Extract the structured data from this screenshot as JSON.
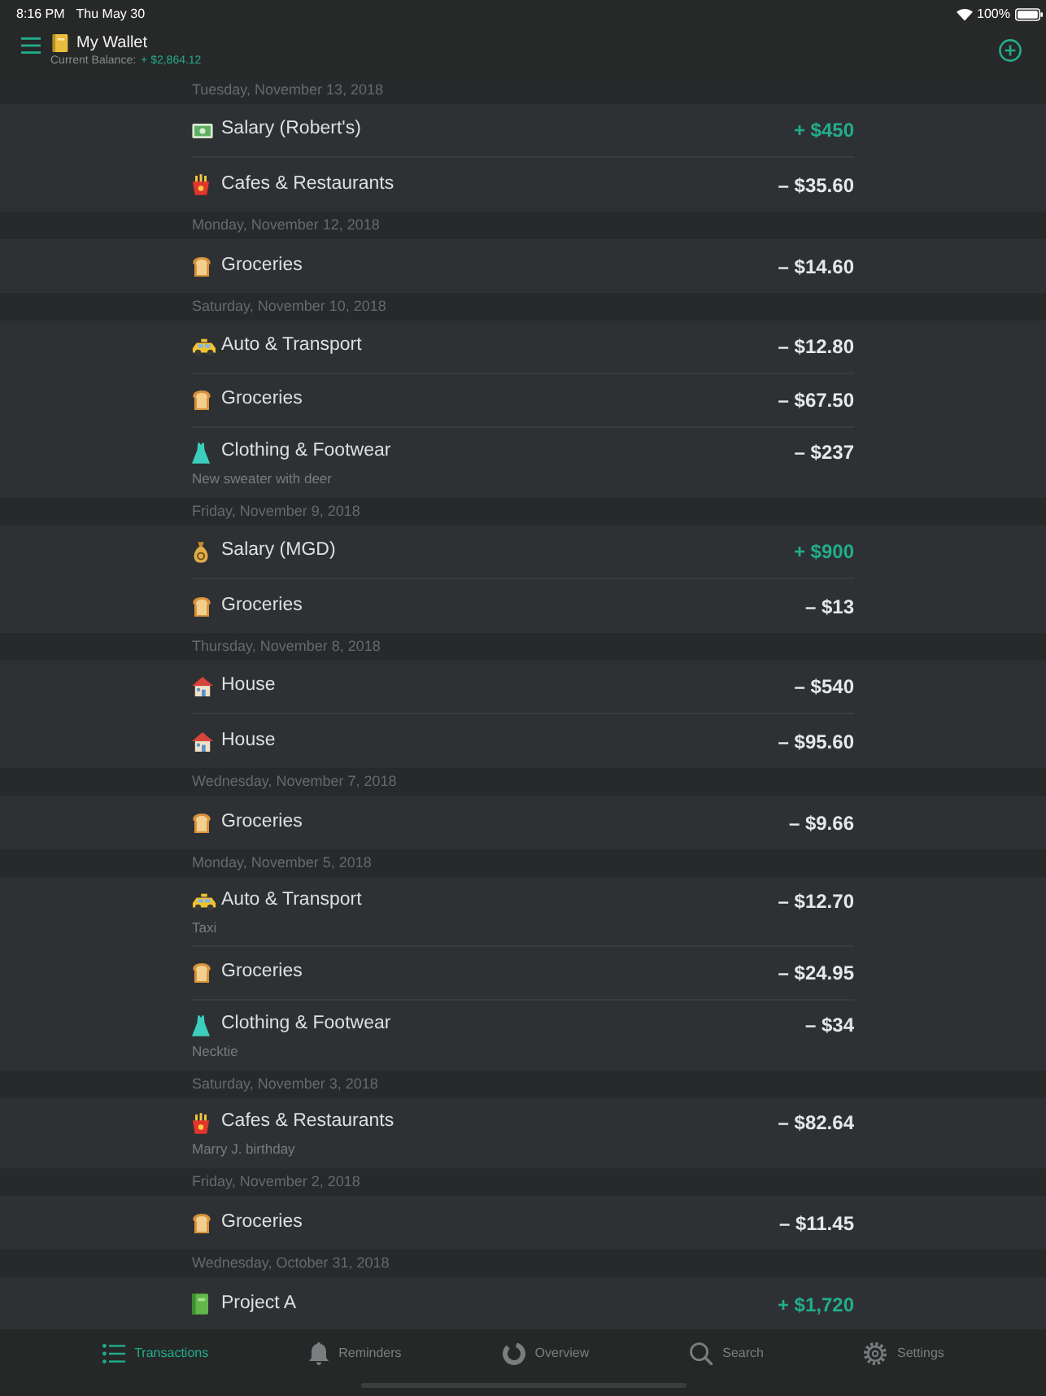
{
  "status_bar": {
    "time": "8:16 PM",
    "date": "Thu May 30",
    "battery": "100%"
  },
  "header": {
    "title": "My Wallet",
    "balance_label": "Current Balance:",
    "balance": "+ $2,864.12"
  },
  "sections": [
    {
      "date": "Tuesday, November 13, 2018",
      "transactions": [
        {
          "kind": "cash",
          "category": "Salary (Robert's)",
          "amount": "+ $450",
          "income": true
        },
        {
          "kind": "fries",
          "category": "Cafes & Restaurants",
          "amount": "– $35.60",
          "income": false
        }
      ]
    },
    {
      "date": "Monday, November 12, 2018",
      "transactions": [
        {
          "kind": "bread",
          "category": "Groceries",
          "amount": "– $14.60",
          "income": false
        }
      ]
    },
    {
      "date": "Saturday, November 10, 2018",
      "transactions": [
        {
          "kind": "taxi",
          "category": "Auto & Transport",
          "amount": "– $12.80",
          "income": false
        },
        {
          "kind": "bread",
          "category": "Groceries",
          "amount": "– $67.50",
          "income": false
        },
        {
          "kind": "dress",
          "category": "Clothing & Footwear",
          "amount": "– $237",
          "income": false,
          "note": "New sweater with deer"
        }
      ]
    },
    {
      "date": "Friday, November 9, 2018",
      "transactions": [
        {
          "kind": "moneybag",
          "category": "Salary (MGD)",
          "amount": "+ $900",
          "income": true
        },
        {
          "kind": "bread",
          "category": "Groceries",
          "amount": "– $13",
          "income": false
        }
      ]
    },
    {
      "date": "Thursday, November 8, 2018",
      "transactions": [
        {
          "kind": "house",
          "category": "House",
          "amount": "– $540",
          "income": false
        },
        {
          "kind": "house",
          "category": "House",
          "amount": "– $95.60",
          "income": false
        }
      ]
    },
    {
      "date": "Wednesday, November 7, 2018",
      "transactions": [
        {
          "kind": "bread",
          "category": "Groceries",
          "amount": "– $9.66",
          "income": false
        }
      ]
    },
    {
      "date": "Monday, November 5, 2018",
      "transactions": [
        {
          "kind": "taxi",
          "category": "Auto & Transport",
          "amount": "– $12.70",
          "income": false,
          "note": "Taxi"
        },
        {
          "kind": "bread",
          "category": "Groceries",
          "amount": "– $24.95",
          "income": false
        },
        {
          "kind": "dress",
          "category": "Clothing & Footwear",
          "amount": "– $34",
          "income": false,
          "note": "Necktie"
        }
      ]
    },
    {
      "date": "Saturday, November 3, 2018",
      "transactions": [
        {
          "kind": "fries",
          "category": "Cafes & Restaurants",
          "amount": "– $82.64",
          "income": false,
          "note": "Marry J. birthday"
        }
      ]
    },
    {
      "date": "Friday, November 2, 2018",
      "transactions": [
        {
          "kind": "bread",
          "category": "Groceries",
          "amount": "– $11.45",
          "income": false
        }
      ]
    },
    {
      "date": "Wednesday, October 31, 2018",
      "transactions": [
        {
          "kind": "book",
          "category": "Project A",
          "amount": "+ $1,720",
          "income": true
        }
      ]
    }
  ],
  "tab_bar": [
    {
      "kind": "list",
      "label": "Transactions",
      "selected": true
    },
    {
      "kind": "bell",
      "label": "Reminders",
      "selected": false
    },
    {
      "kind": "ring",
      "label": "Overview",
      "selected": false
    },
    {
      "kind": "search",
      "label": "Search",
      "selected": false
    },
    {
      "kind": "gear",
      "label": "Settings",
      "selected": false
    }
  ]
}
